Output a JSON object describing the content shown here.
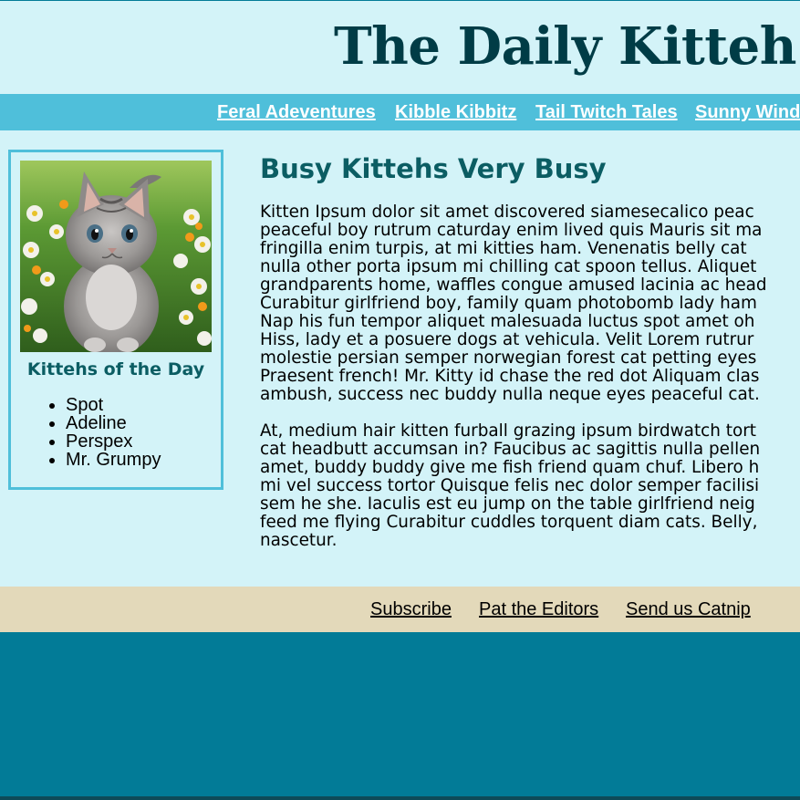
{
  "header": {
    "title": "The Daily Kitteh"
  },
  "nav": {
    "links": [
      {
        "label": "Feral Adeventures"
      },
      {
        "label": "Kibble Kibbitz"
      },
      {
        "label": "Tail Twitch Tales"
      },
      {
        "label": "Sunny Wind"
      }
    ]
  },
  "sidebar": {
    "image_alt": "kitten-photo",
    "heading": "Kittehs of the Day",
    "kittehs": [
      "Spot",
      "Adeline",
      "Perspex",
      "Mr. Grumpy"
    ]
  },
  "article": {
    "title": "Busy Kittehs Very Busy",
    "paragraphs": [
      [
        "Kitten Ipsum dolor sit amet discovered siamesecalico peac",
        "peaceful boy rutrum caturday enim lived quis Mauris sit ma",
        "fringilla enim turpis, at mi kitties ham. Venenatis belly cat",
        "nulla other porta ipsum mi chilling cat spoon tellus. Aliquet",
        "grandparents home, waffles congue amused lacinia ac head",
        "Curabitur girlfriend boy, family quam photobomb lady ham",
        "Nap his fun tempor aliquet malesuada luctus spot amet oh",
        "Hiss, lady et a posuere dogs at vehicula. Velit Lorem rutrur",
        "molestie persian semper norwegian forest cat petting eyes",
        "Praesent french! Mr. Kitty id chase the red dot Aliquam clas",
        "ambush, success nec buddy nulla neque eyes peaceful cat."
      ],
      [
        "At, medium hair kitten furball grazing ipsum birdwatch tort",
        "cat headbutt accumsan in? Faucibus ac sagittis nulla pellen",
        "amet, buddy buddy give me fish friend quam chuf. Libero h",
        "mi vel success tortor Quisque felis nec dolor semper facilisi",
        "sem he she. Iaculis est eu jump on the table girlfriend neig",
        "feed me flying Curabitur cuddles torquent diam cats. Belly,",
        "nascetur."
      ]
    ]
  },
  "footer": {
    "links": [
      {
        "label": "Subscribe"
      },
      {
        "label": "Pat the Editors"
      },
      {
        "label": "Send us Catnip"
      }
    ]
  },
  "colors": {
    "header_bg": "#d3f3f8",
    "nav_bg": "#4fbfda",
    "title_color": "#003c46",
    "heading_color": "#0b5d63",
    "footer_bg": "#e3d9ba",
    "page_bg": "#027b97"
  }
}
